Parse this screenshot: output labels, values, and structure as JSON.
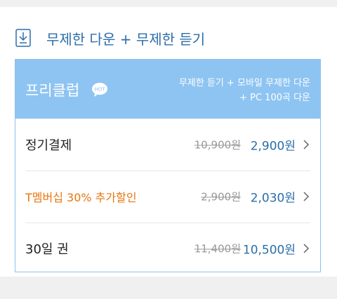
{
  "header": {
    "icon": "download-icon",
    "title": "무제한 다운 + 무제한 듣기"
  },
  "plan": {
    "name": "프리클럽",
    "badge": "HOT",
    "desc_line1": "무제한 듣기 + 모바일 무제한 다운",
    "desc_line2": "+ PC 100곡 다운"
  },
  "options": [
    {
      "label": "정기결제",
      "original_price": "10,900원",
      "price": "2,900원"
    },
    {
      "label": "T멤버십 30% 추가할인",
      "original_price": "2,900원",
      "price": "2,030원"
    },
    {
      "label": "30일 권",
      "original_price": "11,400원",
      "price": "10,500원"
    }
  ],
  "colors": {
    "accent": "#2b6ea8",
    "plan_header_bg": "#8ec4f2",
    "discount_orange": "#e8760f"
  }
}
